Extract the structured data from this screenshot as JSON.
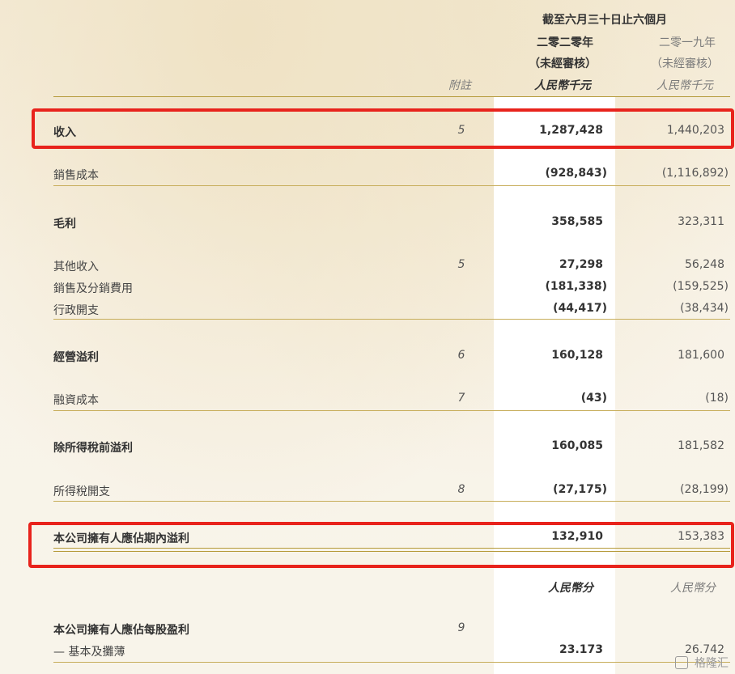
{
  "header": {
    "period": "截至六月三十日止六個月",
    "note_col": "附註",
    "current": {
      "year": "二零二零年",
      "audit": "（未經審核）",
      "unit": "人民幣千元"
    },
    "prior": {
      "year": "二零一九年",
      "audit": "（未經審核）",
      "unit": "人民幣千元"
    }
  },
  "rows": [
    {
      "label": "收入",
      "note": "5",
      "current": "1,287,428",
      "prior": "1,440,203"
    },
    {
      "label": "銷售成本",
      "note": "",
      "current": "(928,843)",
      "prior": "(1,116,892)"
    },
    {
      "label": "毛利",
      "note": "",
      "current": "358,585",
      "prior": "323,311"
    },
    {
      "label": "其他收入",
      "note": "5",
      "current": "27,298",
      "prior": "56,248"
    },
    {
      "label": "銷售及分銷費用",
      "note": "",
      "current": "(181,338)",
      "prior": "(159,525)"
    },
    {
      "label": "行政開支",
      "note": "",
      "current": "(44,417)",
      "prior": "(38,434)"
    },
    {
      "label": "經營溢利",
      "note": "6",
      "current": "160,128",
      "prior": "181,600"
    },
    {
      "label": "融資成本",
      "note": "7",
      "current": "(43)",
      "prior": "(18)"
    },
    {
      "label": "除所得稅前溢利",
      "note": "",
      "current": "160,085",
      "prior": "181,582"
    },
    {
      "label": "所得稅開支",
      "note": "8",
      "current": "(27,175)",
      "prior": "(28,199)"
    },
    {
      "label": "本公司擁有人應佔期內溢利",
      "note": "",
      "current": "132,910",
      "prior": "153,383"
    }
  ],
  "eps": {
    "unit_current": "人民幣分",
    "unit_prior": "人民幣分",
    "label": "本公司擁有人應佔每股盈利",
    "note": "9",
    "basic_label": "— 基本及攤薄",
    "current": "23.173",
    "prior": "26.742"
  },
  "watermark": "格隆汇"
}
